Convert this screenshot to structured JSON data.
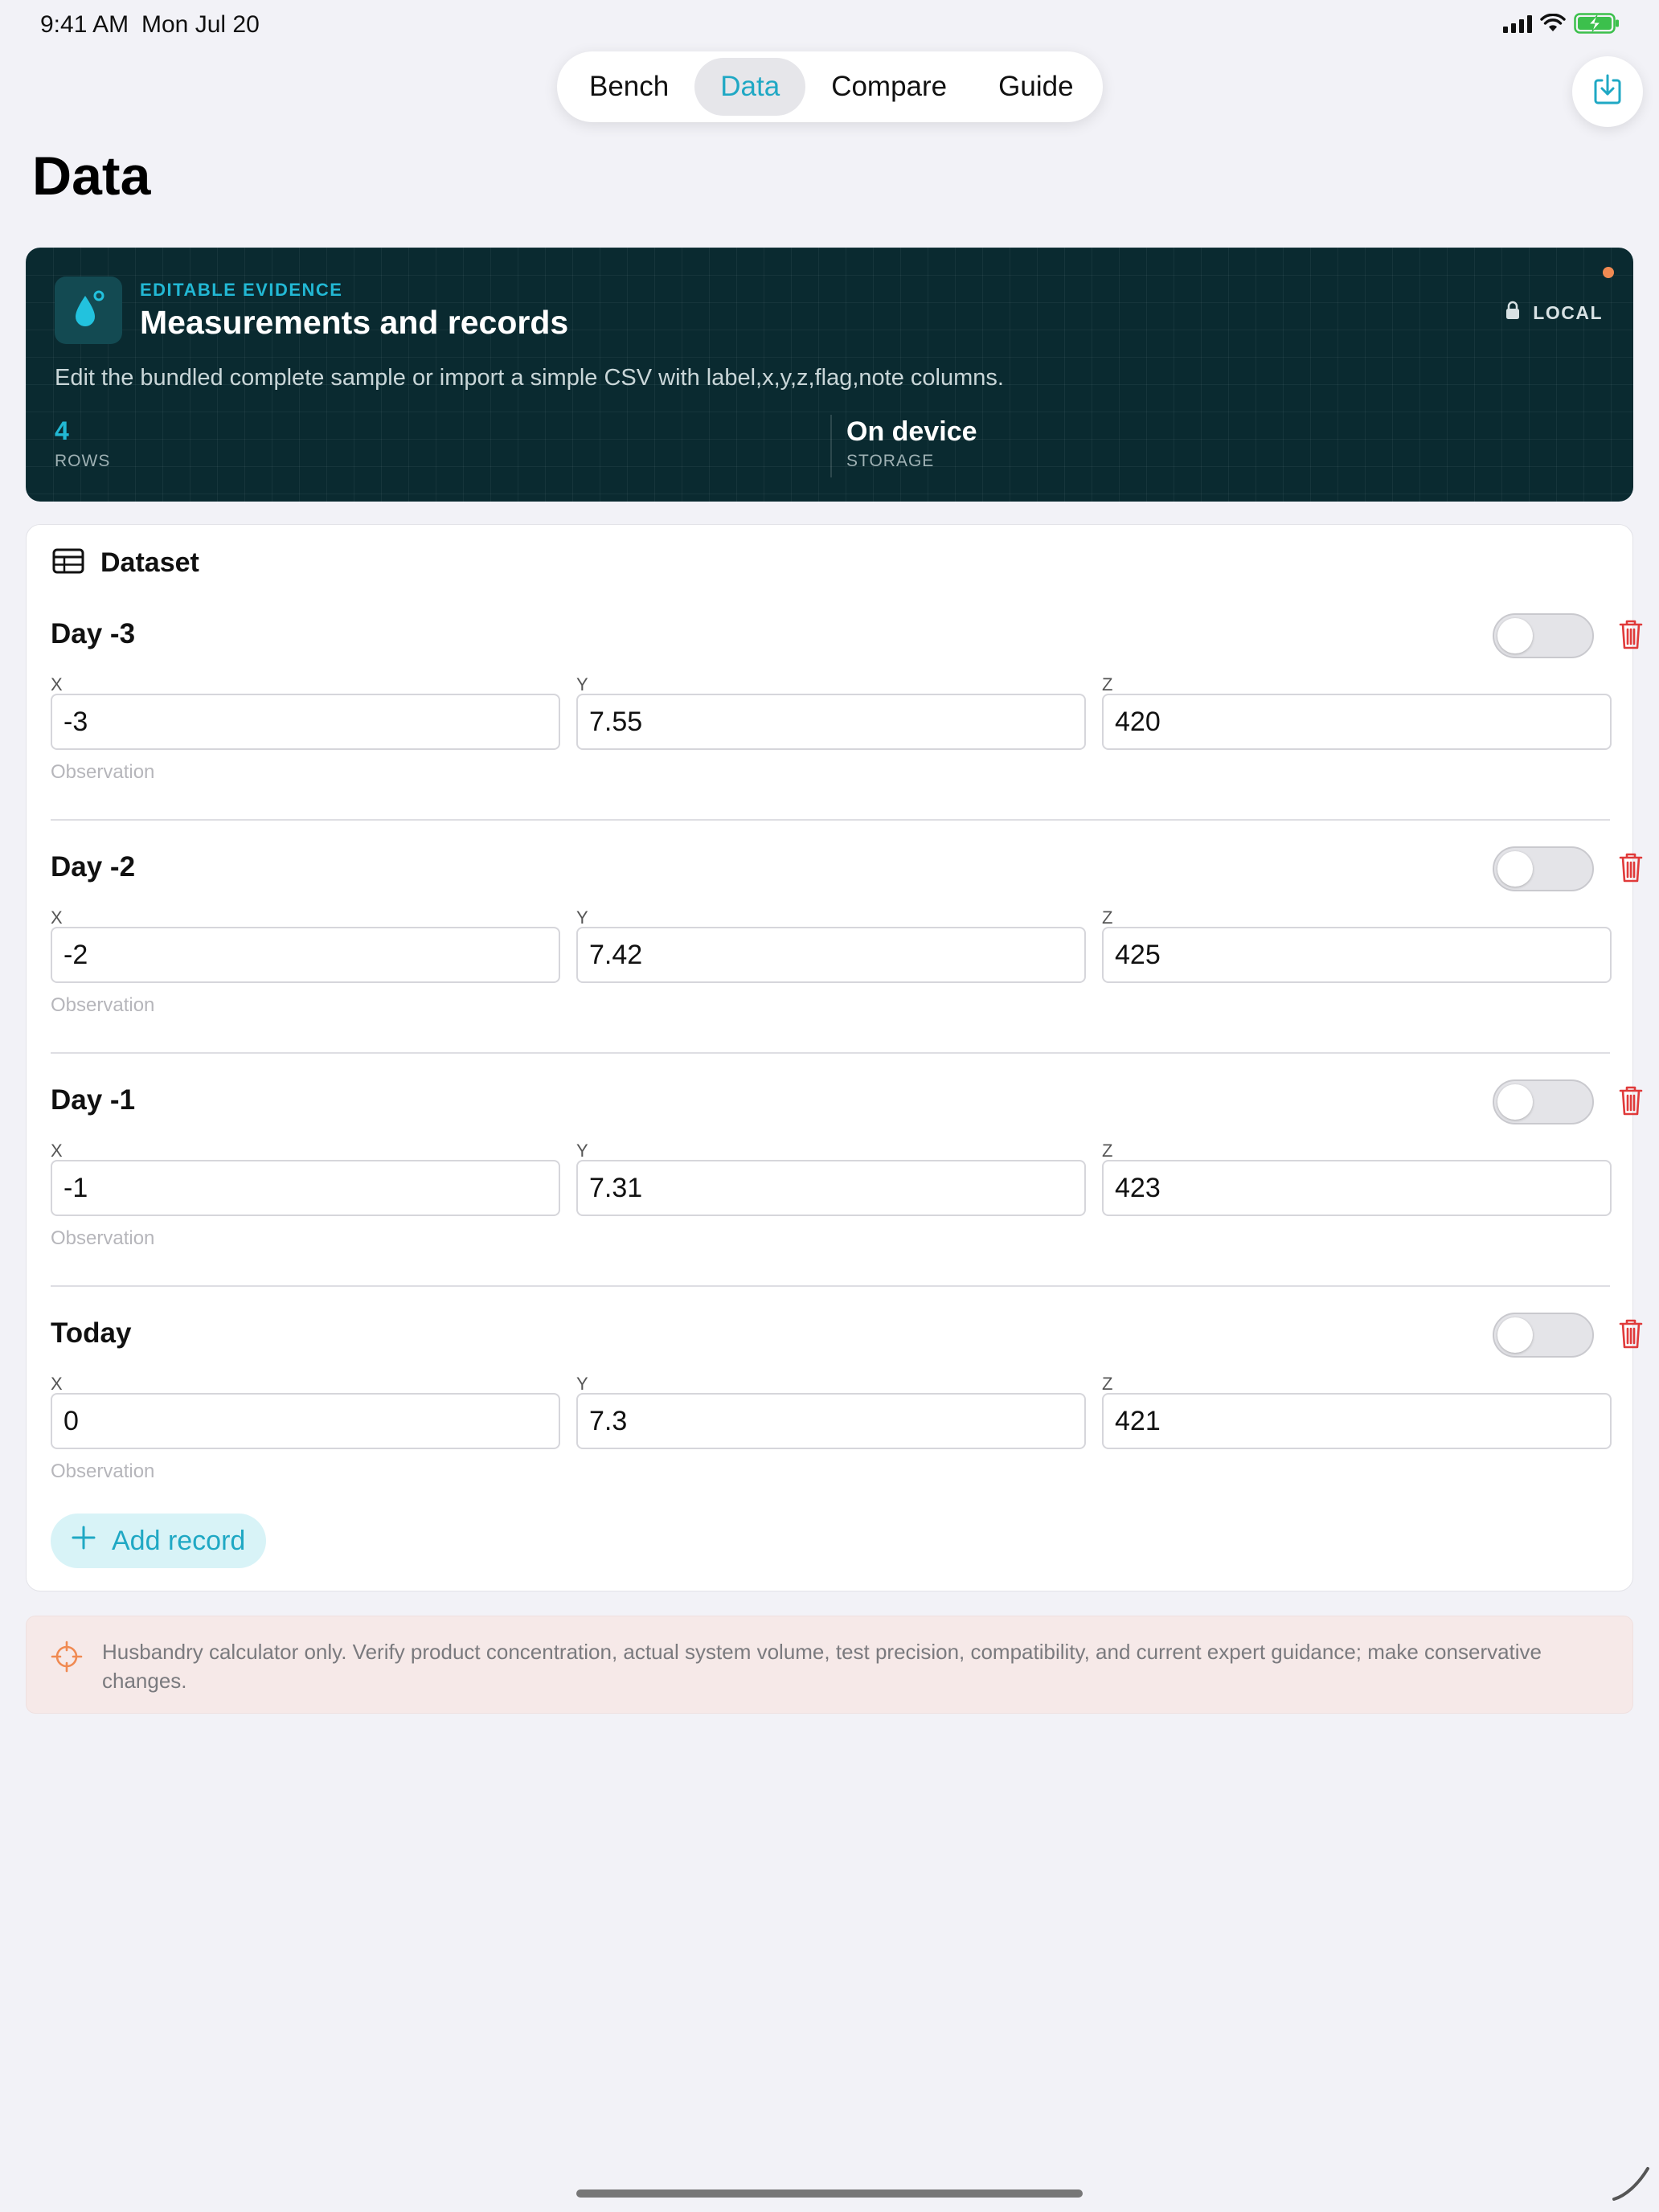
{
  "status_bar": {
    "time": "9:41 AM",
    "date": "Mon Jul 20"
  },
  "nav": {
    "tabs": [
      {
        "label": "Bench",
        "active": false
      },
      {
        "label": "Data",
        "active": true
      },
      {
        "label": "Compare",
        "active": false
      },
      {
        "label": "Guide",
        "active": false
      }
    ],
    "export_icon": "export-download-icon"
  },
  "page": {
    "title": "Data"
  },
  "hero": {
    "eyebrow": "EDITABLE EVIDENCE",
    "title": "Measurements and records",
    "badge": "LOCAL",
    "description": "Edit the bundled complete sample or import a simple CSV with label,x,y,z,flag,note columns.",
    "stats": [
      {
        "value": "4",
        "label": "ROWS"
      },
      {
        "value": "On device",
        "label": "STORAGE"
      }
    ],
    "accent_color": "#22b8d4",
    "background_color": "#0a2a30"
  },
  "dataset": {
    "title": "Dataset",
    "field_labels": {
      "x": "X",
      "y": "Y",
      "z": "Z"
    },
    "observation_placeholder": "Observation",
    "records": [
      {
        "label": "Day -3",
        "x": "-3",
        "y": "7.55",
        "z": "420",
        "flag": false
      },
      {
        "label": "Day -2",
        "x": "-2",
        "y": "7.42",
        "z": "425",
        "flag": false
      },
      {
        "label": "Day -1",
        "x": "-1",
        "y": "7.31",
        "z": "423",
        "flag": false
      },
      {
        "label": "Today",
        "x": "0",
        "y": "7.3",
        "z": "421",
        "flag": false
      }
    ],
    "add_label": "Add record"
  },
  "disclaimer": {
    "text": "Husbandry calculator only. Verify product concentration, actual system volume, test precision, compatibility, and current expert guidance; make conservative changes."
  },
  "colors": {
    "accent": "#1fa8c4",
    "danger": "#e03a3a",
    "warning": "#f08a52"
  }
}
